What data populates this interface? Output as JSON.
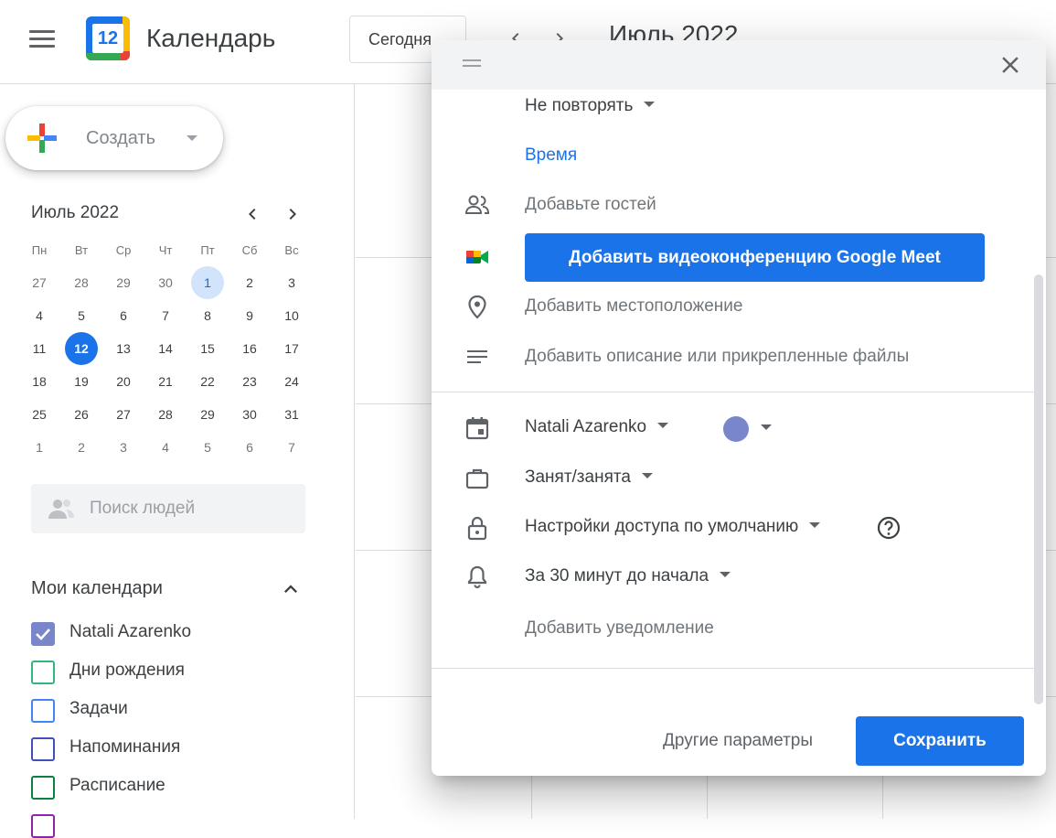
{
  "colors": {
    "accent": "#1a73e8",
    "today_bg": "#1a73e8",
    "selected_bg": "#d2e3fc",
    "event_color": "#7986cb"
  },
  "header": {
    "app_title": "Календарь",
    "logo_number": "12",
    "today_label": "Сегодня",
    "month_title": "Июль 2022"
  },
  "sidebar": {
    "create_label": "Создать",
    "mini_calendar": {
      "title": "Июль 2022",
      "weekdays": [
        "Пн",
        "Вт",
        "Ср",
        "Чт",
        "Пт",
        "Сб",
        "Вс"
      ],
      "weeks": [
        [
          "27",
          "28",
          "29",
          "30",
          "1",
          "2",
          "3"
        ],
        [
          "4",
          "5",
          "6",
          "7",
          "8",
          "9",
          "10"
        ],
        [
          "11",
          "12",
          "13",
          "14",
          "15",
          "16",
          "17"
        ],
        [
          "18",
          "19",
          "20",
          "21",
          "22",
          "23",
          "24"
        ],
        [
          "25",
          "26",
          "27",
          "28",
          "29",
          "30",
          "31"
        ],
        [
          "1",
          "2",
          "3",
          "4",
          "5",
          "6",
          "7"
        ]
      ]
    },
    "people_search_placeholder": "Поиск людей",
    "my_calendars_title": "Мои календари",
    "calendars": [
      {
        "label": "Natali Azarenko",
        "color": "#7986cb",
        "checked": true
      },
      {
        "label": "Дни рождения",
        "color": "#33b679",
        "checked": false
      },
      {
        "label": "Задачи",
        "color": "#4285f4",
        "checked": false
      },
      {
        "label": "Напоминания",
        "color": "#3f51b5",
        "checked": false
      },
      {
        "label": "Расписание",
        "color": "#0b8043",
        "checked": false
      }
    ]
  },
  "dialog": {
    "repeat_label": "Не повторять",
    "time_link": "Время",
    "guests_placeholder": "Добавьте гостей",
    "meet_button": "Добавить видеоконференцию Google Meet",
    "location_placeholder": "Добавить местоположение",
    "description_placeholder": "Добавить описание или прикрепленные файлы",
    "calendar_owner": "Natali Azarenko",
    "busy_status": "Занят/занята",
    "visibility": "Настройки доступа по умолчанию",
    "notification": "За 30 минут до начала",
    "add_notification": "Добавить уведомление",
    "more_options": "Другие параметры",
    "save": "Сохранить"
  }
}
